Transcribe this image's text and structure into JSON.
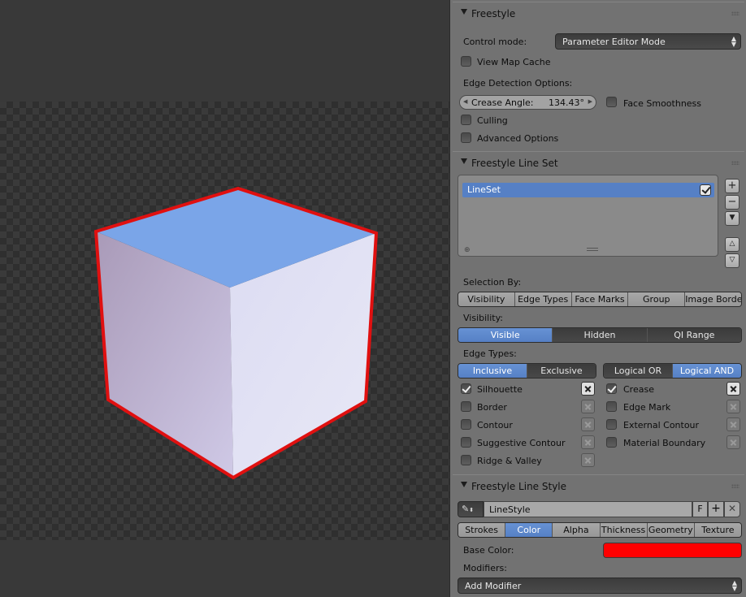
{
  "colors": {
    "accent": "#5680c5",
    "cube_top": "#7aa5e8",
    "cube_outline": "#e01010",
    "base_color": "#ff0000"
  },
  "freestyle": {
    "title": "Freestyle",
    "control_mode_label": "Control mode:",
    "control_mode_value": "Parameter Editor Mode",
    "view_map_cache": "View Map Cache",
    "edge_detection_label": "Edge Detection Options:",
    "crease_angle_label": "Crease Angle:",
    "crease_angle_value": "134.43°",
    "face_smoothness": "Face Smoothness",
    "culling": "Culling",
    "advanced_options": "Advanced Options"
  },
  "lineset": {
    "title": "Freestyle Line Set",
    "items": [
      {
        "name": "LineSet",
        "enabled": true
      }
    ],
    "selection_by_label": "Selection By:",
    "selection_tabs": [
      "Visibility",
      "Edge Types",
      "Face Marks",
      "Group",
      "Image Border"
    ],
    "selection_active": [
      1,
      1,
      0,
      0,
      0
    ],
    "visibility_label": "Visibility:",
    "visibility_tabs": [
      "Visible",
      "Hidden",
      "QI Range"
    ],
    "edge_types_label": "Edge Types:",
    "inclusive": "Inclusive",
    "exclusive": "Exclusive",
    "logical_or": "Logical OR",
    "logical_and": "Logical AND",
    "edge_types_left": [
      {
        "label": "Silhouette",
        "checked": true
      },
      {
        "label": "Border",
        "checked": false
      },
      {
        "label": "Contour",
        "checked": false
      },
      {
        "label": "Suggestive Contour",
        "checked": false
      },
      {
        "label": "Ridge & Valley",
        "checked": false
      }
    ],
    "edge_types_right": [
      {
        "label": "Crease",
        "checked": true
      },
      {
        "label": "Edge Mark",
        "checked": false
      },
      {
        "label": "External Contour",
        "checked": false
      },
      {
        "label": "Material Boundary",
        "checked": false
      }
    ]
  },
  "linestyle": {
    "title": "Freestyle Line Style",
    "name": "LineStyle",
    "fake_user": "F",
    "tabs": [
      "Strokes",
      "Color",
      "Alpha",
      "Thickness",
      "Geometry",
      "Texture"
    ],
    "active_tab": "Color",
    "base_color_label": "Base Color:",
    "modifiers_label": "Modifiers:",
    "add_modifier": "Add Modifier"
  }
}
